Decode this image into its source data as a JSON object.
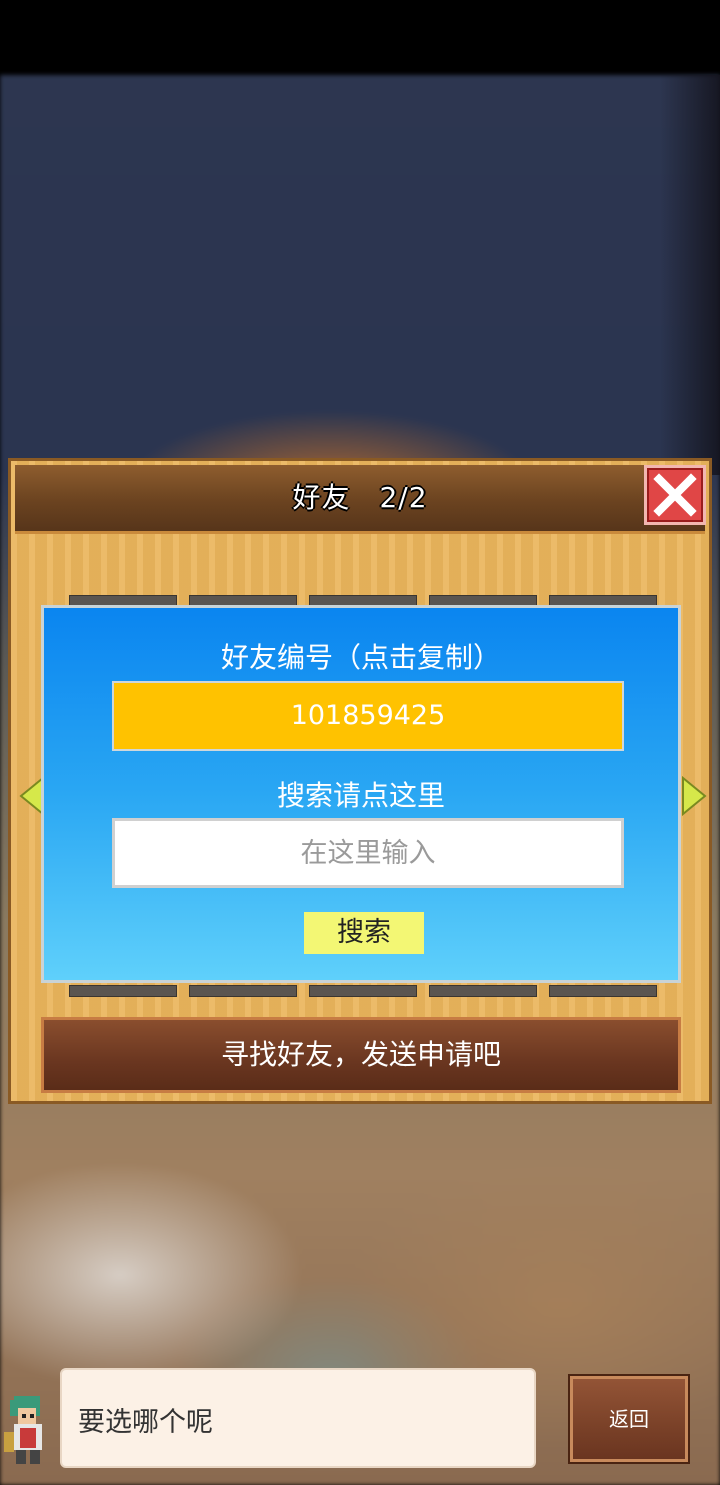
{
  "dialog": {
    "title": "好友　2/2",
    "panel": {
      "friend_id_label": "好友编号（点击复制）",
      "friend_id_value": "101859425",
      "search_label": "搜索请点这里",
      "search_placeholder": "在这里输入",
      "search_button": "搜索"
    },
    "find_friends_button": "寻找好友，发送申请吧"
  },
  "bottom": {
    "speech_text": "要选哪个呢",
    "back_button": "返回"
  },
  "colors": {
    "panel_blue": "#1a95f2",
    "id_field_yellow": "#ffc200",
    "search_button_yellow": "#f3f774",
    "close_red": "#e04646",
    "wood": "#eab55c"
  },
  "icons": [
    "close-icon",
    "arrow-left-icon",
    "arrow-right-icon",
    "character-avatar"
  ]
}
